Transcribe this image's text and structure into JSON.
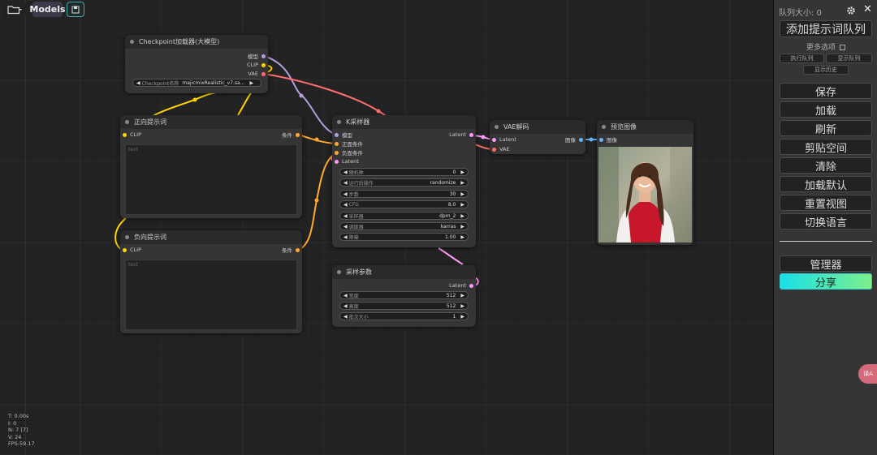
{
  "topbar": {
    "models_label": "Models"
  },
  "nodes": {
    "checkpoint": {
      "title": "Checkpoint加载器(大模型)",
      "outputs": [
        "模型",
        "CLIP",
        "VAE"
      ],
      "widget_label": "Checkpoint名称",
      "widget_value": "majicmixRealistic_v7.sa..."
    },
    "pos_prompt": {
      "title": "正向提示词",
      "input": "CLIP",
      "output": "条件",
      "placeholder": "text"
    },
    "neg_prompt": {
      "title": "负向提示词",
      "input": "CLIP",
      "output": "条件",
      "placeholder": "text"
    },
    "ksampler": {
      "title": "K采样器",
      "inputs": [
        "模型",
        "正面条件",
        "负面条件",
        "Latent"
      ],
      "output": "Latent",
      "widgets": [
        {
          "label": "随机种",
          "value": "0"
        },
        {
          "label": "运行后操作",
          "value": "randomize"
        },
        {
          "label": "步数",
          "value": "30"
        },
        {
          "label": "CFG",
          "value": "8.0"
        },
        {
          "label": "采样器",
          "value": "dpm_2"
        },
        {
          "label": "调度器",
          "value": "karras"
        },
        {
          "label": "降噪",
          "value": "1.00"
        }
      ]
    },
    "vae_decode": {
      "title": "VAE解码",
      "inputs": [
        "Latent",
        "VAE"
      ],
      "output": "图像"
    },
    "preview": {
      "title": "预览图像",
      "input": "图像"
    },
    "latent": {
      "title": "采样参数",
      "output": "Latent",
      "widgets": [
        {
          "label": "宽度",
          "value": "512"
        },
        {
          "label": "高度",
          "value": "512"
        },
        {
          "label": "批次大小",
          "value": "1"
        }
      ]
    }
  },
  "stats": [
    "T: 0.00s",
    "I: 0",
    "N: 7 [7]",
    "V: 24",
    "FPS:59.17"
  ],
  "panel": {
    "queue_size": "队列大小: 0",
    "queue_prompt": "添加提示词队列",
    "more_options": "更多选项",
    "view_queue": "执行队列",
    "show_queue": "显示队列",
    "show_history": "显示历史",
    "buttons": [
      "保存",
      "加载",
      "刷新",
      "剪贴空间",
      "清除",
      "加载默认",
      "重置视图",
      "切换语言"
    ],
    "manager": "管理器",
    "share": "分享"
  },
  "colors": {
    "model": "#b39ddb",
    "clip": "#ffd500",
    "vae": "#ff6e6e",
    "conditioning": "#ffa931",
    "latent": "#ff9cf9",
    "image": "#64b5f6",
    "share_from": "#19e0e8",
    "share_to": "#7cf08b"
  }
}
